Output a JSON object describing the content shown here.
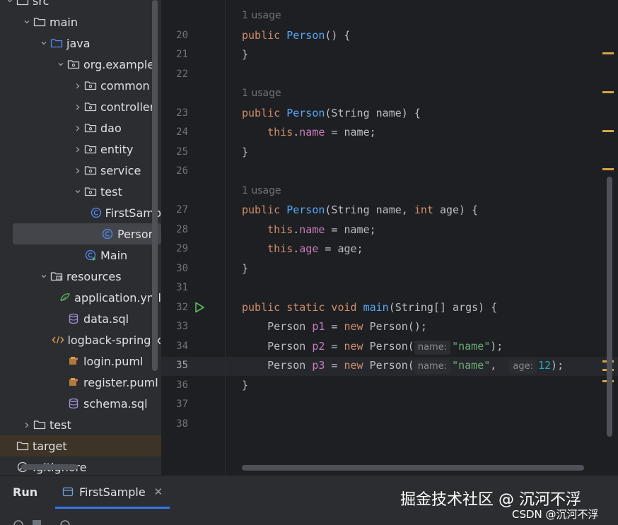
{
  "project_tree": {
    "items": [
      {
        "label": "src",
        "icon": "folder-icon",
        "depth": 0,
        "expanded": true
      },
      {
        "label": "main",
        "icon": "folder-icon",
        "depth": 1,
        "expanded": true
      },
      {
        "label": "java",
        "icon": "source-folder-icon",
        "depth": 2,
        "expanded": true
      },
      {
        "label": "org.example",
        "icon": "package-icon",
        "depth": 3,
        "expanded": true
      },
      {
        "label": "common",
        "icon": "package-icon",
        "depth": 4,
        "expanded": false
      },
      {
        "label": "controller",
        "icon": "package-icon",
        "depth": 4,
        "expanded": false
      },
      {
        "label": "dao",
        "icon": "package-icon",
        "depth": 4,
        "expanded": false
      },
      {
        "label": "entity",
        "icon": "package-icon",
        "depth": 4,
        "expanded": false
      },
      {
        "label": "service",
        "icon": "package-icon",
        "depth": 4,
        "expanded": false
      },
      {
        "label": "test",
        "icon": "package-icon",
        "depth": 4,
        "expanded": true
      },
      {
        "label": "FirstSamp",
        "icon": "class-icon",
        "depth": 5
      },
      {
        "label": "Person",
        "icon": "class-icon",
        "depth": 5,
        "selected": true
      },
      {
        "label": "Main",
        "icon": "class-main-icon",
        "depth": 4
      },
      {
        "label": "resources",
        "icon": "resources-folder-icon",
        "depth": 2,
        "expanded": true
      },
      {
        "label": "application.yml",
        "icon": "yaml-icon",
        "depth": 3
      },
      {
        "label": "data.sql",
        "icon": "database-icon",
        "depth": 3
      },
      {
        "label": "logback-spring.x",
        "icon": "xml-icon",
        "depth": 3
      },
      {
        "label": "login.puml",
        "icon": "puml-icon",
        "depth": 3
      },
      {
        "label": "register.puml",
        "icon": "puml-icon",
        "depth": 3
      },
      {
        "label": "schema.sql",
        "icon": "database-icon",
        "depth": 3
      },
      {
        "label": "test",
        "icon": "folder-icon",
        "depth": 1,
        "expanded": false
      },
      {
        "label": "target",
        "icon": "folder-icon",
        "depth": 0,
        "excluded": true
      },
      {
        "label": ".gitignore",
        "icon": "ignore-file-icon",
        "depth": 0
      }
    ]
  },
  "editor": {
    "usage_label": "1 usage",
    "lines": [
      {
        "num": "20",
        "tokens": [
          [
            "kw",
            "public "
          ],
          [
            "fn",
            "Person"
          ],
          [
            "p",
            "() {"
          ]
        ]
      },
      {
        "num": "21",
        "tokens": [
          [
            "p",
            "}"
          ]
        ]
      },
      {
        "num": "22",
        "tokens": []
      },
      {
        "num": "23",
        "tokens": [
          [
            "kw",
            "public "
          ],
          [
            "fn",
            "Person"
          ],
          [
            "p",
            "(String name) {"
          ]
        ]
      },
      {
        "num": "24",
        "tokens": [
          [
            "p",
            "    "
          ],
          [
            "kw",
            "this"
          ],
          [
            "p",
            "."
          ],
          [
            "fld",
            "name"
          ],
          [
            "p",
            " = name;"
          ]
        ]
      },
      {
        "num": "25",
        "tokens": [
          [
            "p",
            "}"
          ]
        ]
      },
      {
        "num": "26",
        "tokens": []
      },
      {
        "num": "27",
        "tokens": [
          [
            "kw",
            "public "
          ],
          [
            "fn",
            "Person"
          ],
          [
            "p",
            "(String name, "
          ],
          [
            "kw",
            "int"
          ],
          [
            "p",
            " age) {"
          ]
        ]
      },
      {
        "num": "28",
        "tokens": [
          [
            "p",
            "    "
          ],
          [
            "kw",
            "this"
          ],
          [
            "p",
            "."
          ],
          [
            "fld",
            "name"
          ],
          [
            "p",
            " = name;"
          ]
        ]
      },
      {
        "num": "29",
        "tokens": [
          [
            "p",
            "    "
          ],
          [
            "kw",
            "this"
          ],
          [
            "p",
            "."
          ],
          [
            "fld",
            "age"
          ],
          [
            "p",
            " = age;"
          ]
        ]
      },
      {
        "num": "30",
        "tokens": [
          [
            "p",
            "}"
          ]
        ]
      },
      {
        "num": "31",
        "tokens": []
      },
      {
        "num": "32",
        "tokens": [
          [
            "kw",
            "public static void "
          ],
          [
            "fn",
            "main"
          ],
          [
            "p",
            "(String[] args) {"
          ]
        ]
      },
      {
        "num": "33",
        "tokens": [
          [
            "p",
            "    Person "
          ],
          [
            "fld",
            "p1"
          ],
          [
            "p",
            " = "
          ],
          [
            "kw",
            "new"
          ],
          [
            "p",
            " Person();"
          ]
        ]
      },
      {
        "num": "34",
        "tokens": [
          [
            "p",
            "    Person "
          ],
          [
            "fld",
            "p2"
          ],
          [
            "p",
            " = "
          ],
          [
            "kw",
            "new"
          ],
          [
            "p",
            " Person("
          ],
          [
            "hint",
            "name:"
          ],
          [
            "str",
            "\"name\""
          ],
          [
            "p",
            ");"
          ]
        ]
      },
      {
        "num": "35",
        "tokens": [
          [
            "p",
            "    Person "
          ],
          [
            "fld",
            "p3"
          ],
          [
            "p",
            " = "
          ],
          [
            "kw",
            "new"
          ],
          [
            "p",
            " Person("
          ],
          [
            "hint",
            "name:"
          ],
          [
            "str",
            "\"name\""
          ],
          [
            "p",
            ",  "
          ],
          [
            "hint",
            "age:"
          ],
          [
            "num",
            "12"
          ],
          [
            "p",
            ");"
          ]
        ],
        "current": true
      },
      {
        "num": "36",
        "tokens": [
          [
            "p",
            "}"
          ]
        ]
      },
      {
        "num": "37",
        "tokens": []
      },
      {
        "num": "38",
        "tokens": []
      }
    ]
  },
  "bottom_bar": {
    "run_label": "Run",
    "tab_label": "FirstSample",
    "close_icon": "close-icon"
  },
  "watermark": {
    "main": "掘金技术社区 @ 沉河不浮",
    "csdn": "CSDN @沉河不浮"
  },
  "colors": {
    "background": "#1e1f22",
    "panel": "#2b2d30",
    "keyword": "#cf8e6d",
    "function": "#56a8f5",
    "field": "#c77dba",
    "string": "#6aab73",
    "number": "#2aacb8",
    "accent": "#3574f0",
    "marker": "#d9a343"
  }
}
